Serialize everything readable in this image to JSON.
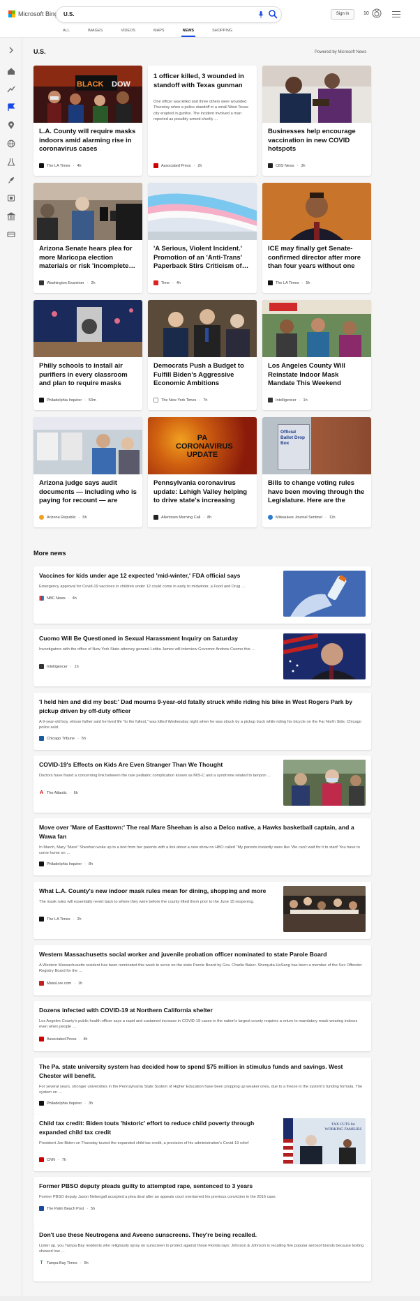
{
  "header": {
    "logo_text": "Microsoft Bing",
    "search_query": "U.S.",
    "signin_label": "Sign in",
    "points": "10",
    "tabs": [
      {
        "label": "ALL"
      },
      {
        "label": "IMAGES"
      },
      {
        "label": "VIDEOS"
      },
      {
        "label": "MAPS"
      },
      {
        "label": "NEWS",
        "active": true
      },
      {
        "label": "SHOPPING"
      }
    ]
  },
  "page": {
    "section_title": "U.S.",
    "powered_by": "Powered by Microsoft News",
    "more_news_title": "More news"
  },
  "cards": [
    {
      "title": "L.A. County will require masks indoors amid alarming rise in coronavirus cases",
      "source": "The LA Times",
      "age": "4h",
      "icon": "la-times-icon",
      "image": "masked-crowd-image"
    },
    {
      "title": "1 officer killed, 3 wounded in standoff with Texas gunman",
      "snippet": "One officer was killed and three others were wounded Thursday when a police standoff in a small West Texas city erupted in gunfire. The incident involved a man reported as possibly armed shortly …",
      "source": "Associated Press",
      "age": "2h",
      "icon": "ap-icon"
    },
    {
      "title": "Businesses help encourage vaccination in new COVID hotspots",
      "source": "CBS News",
      "age": "3h",
      "icon": "cbs-icon",
      "image": "vaccination-image"
    },
    {
      "title": "Arizona Senate hears plea for more Maricopa election materials or risk 'incomplete…",
      "source": "Washington Examiner",
      "age": "2h",
      "icon": "washington-examiner-icon",
      "image": "press-microphones-image"
    },
    {
      "title": "'A Serious, Violent Incident.' Promotion of an 'Anti-Trans' Paperback Stirs Criticism of…",
      "source": "Time",
      "age": "4h",
      "icon": "time-icon",
      "image": "trans-flag-image"
    },
    {
      "title": "ICE may finally get Senate-confirmed director after more than four years without one",
      "source": "The LA Times",
      "age": "5h",
      "icon": "la-times-icon",
      "image": "official-portrait-image"
    },
    {
      "title": "Philly schools to install air purifiers in every classroom and plan to require masks for…",
      "source": "Philadelphia Inquirer",
      "age": "53m",
      "icon": "inquirer-icon",
      "image": "air-purifier-image"
    },
    {
      "title": "Democrats Push a Budget to Fulfill Biden's Aggressive Economic Ambitions",
      "source": "The New York Times",
      "age": "7h",
      "icon": "nyt-icon",
      "image": "senators-image"
    },
    {
      "title": "Los Angeles County Will Reinstate Indoor Mask Mandate This Weekend",
      "source": "Intelligencer",
      "age": "1h",
      "icon": "intelligencer-icon",
      "image": "market-crowd-image"
    },
    {
      "title": "Arizona judge says audit documents — including who is paying for recount — are publi…",
      "source": "Arizona Republic",
      "age": "5h",
      "icon": "arizona-republic-icon",
      "image": "ballot-audit-image"
    },
    {
      "title": "Pennsylvania coronavirus update: Lehigh Valley helping to drive state's increasing cas…",
      "source": "Allentown Morning Call",
      "age": "8h",
      "icon": "morning-call-icon",
      "image": "pa-coronavirus-update-image",
      "image_caption": "PA CORONAVIRUS UPDATE"
    },
    {
      "title": "Bills to change voting rules have been moving through the Legislature. Here are the view…",
      "source": "Milwaukee Journal Sentinel",
      "age": "11h",
      "icon": "journal-sentinel-icon",
      "image": "ballot-drop-box-image",
      "image_caption": "Official Ballot Drop Box"
    }
  ],
  "more_news": [
    {
      "title": "Vaccines for kids under age 12 expected 'mid-winter,' FDA official says",
      "snippet": "Emergency approval for Covid-19 vaccines in children under 12 could come in early to midwinter, a Food and Drug …",
      "source": "NBC News",
      "age": "4h",
      "icon": "nbc-icon",
      "image": "vaccine-vial-image"
    },
    {
      "title": "Cuomo Will Be Questioned in Sexual Harassment Inquiry on Saturday",
      "snippet": "Investigators with the office of New York State attorney general Letitia James will interview Governor Andrew Cuomo this …",
      "source": "Intelligencer",
      "age": "1h",
      "icon": "intelligencer-icon",
      "image": "cuomo-flag-image"
    },
    {
      "title": "'I held him and did my best:' Dad mourns 9-year-old fatally struck while riding his bike in West Rogers Park by pickup driven by off-duty officer",
      "snippet": "A 9-year-old boy, whose father said he lived life \"to the fullest,\" was killed Wednesday night when he was struck by a pickup truck while riding his bicycle on the Far North Side, Chicago police said.",
      "source": "Chicago Tribune",
      "age": "5h",
      "icon": "chicago-tribune-icon"
    },
    {
      "title": "COVID-19's Effects on Kids Are Even Stranger Than We Thought",
      "snippet": "Doctors have found a concerning link between the rare pediatric complication known as MIS-C and a syndrome related to tampon …",
      "source": "The Atlantic",
      "age": "6h",
      "icon": "atlantic-icon",
      "image": "masked-kids-image"
    },
    {
      "title": "Move over 'Mare of Easttown:' The real Mare Sheehan is also a Delco native, a Hawks basketball captain, and a Wawa fan",
      "snippet": "In March, Mary \"Mare\" Sheehan woke up to a text from her parents with a link about a new show on HBO called \"My parents instantly were like 'We can't wait for it to start! You have to come home on …",
      "source": "Philadelphia Inquirer",
      "age": "8h",
      "icon": "inquirer-icon"
    },
    {
      "title": "What L.A. County's new indoor mask rules mean for dining, shopping and more",
      "snippet": "The mask rules will essentially revert back to where they were before the county lifted them prior to the June 15 reopening.",
      "source": "The LA Times",
      "age": "2h",
      "icon": "la-times-icon",
      "image": "restaurant-crowd-image"
    },
    {
      "title": "Western Massachusetts social worker and juvenile probation officer nominated to state Parole Board",
      "snippet": "A Western Massachusetts resident has been nominated this week to serve on the state Parole Board by Gov. Charlie Baker. Sherquita HoSang has been a member of the Sex Offender Registry Board for the …",
      "source": "MassLive.com",
      "age": "1h",
      "icon": "masslive-icon"
    },
    {
      "title": "Dozens infected with COVID-19 at Northern California shelter",
      "snippet": "Los Angeles County's public health officer says a rapid and sustained increase in COVID-19 cases in the nation's largest county requires a return to mandatory mask-wearing indoors even when people …",
      "source": "Associated Press",
      "age": "4h",
      "icon": "ap-icon"
    },
    {
      "title": "The Pa. state university system has decided how to spend $75 million in stimulus funds and savings. West Chester will benefit.",
      "snippet": "For several years, stronger universities in the Pennsylvania State System of Higher Education have been propping up weaker ones, due to a freeze in the system's funding formula. The system on …",
      "source": "Philadelphia Inquirer",
      "age": "3h",
      "icon": "inquirer-icon"
    },
    {
      "title": "Child tax credit: Biden touts 'historic' effort to reduce child poverty through expanded child tax credit",
      "snippet": "President Joe Biden on Thursday touted the expanded child tax credit, a provision of his administration's Covid-19 relief",
      "source": "CNN",
      "age": "7h",
      "icon": "cnn-icon",
      "image": "biden-podium-image",
      "image_caption": "TAX CUTS for WORKING FAMILIES"
    },
    {
      "title": "Former PBSO deputy pleads guilty to attempted rape, sentenced to 3 years",
      "snippet": "Former PBSO deputy Jason Nebergall accepted a plea deal after an appeals court overturned his previous conviction in the 2016 case.",
      "source": "The Palm Beach Post",
      "age": "5h",
      "icon": "palm-beach-post-icon"
    },
    {
      "title": "Don't use these Neutrogena and Aveeno sunscreens. They're being recalled.",
      "snippet": "Listen up, you Tampa Bay residents who religiously spray on sunscreen to protect against those Florida rays: Johnson & Johnson is recalling five popular aerosol brands because testing showed low …",
      "source": "Tampa Bay Times",
      "age": "5h",
      "icon": "tampa-bay-times-icon"
    }
  ],
  "colors": {
    "accent": "#174ae4",
    "page_bg": "#f5f5f5",
    "card_bg": "#ffffff"
  }
}
